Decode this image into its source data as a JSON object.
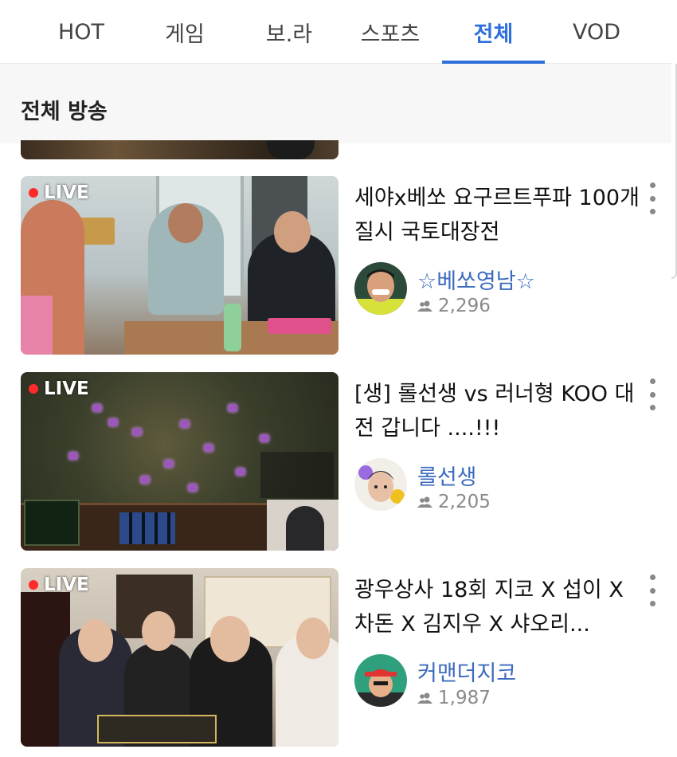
{
  "tabs": [
    {
      "label": "HOT",
      "active": false
    },
    {
      "label": "게임",
      "active": false
    },
    {
      "label": "보.라",
      "active": false
    },
    {
      "label": "스포츠",
      "active": false
    },
    {
      "label": "전체",
      "active": true
    },
    {
      "label": "VOD",
      "active": false
    }
  ],
  "colors": {
    "accent": "#2f6fdb",
    "channel": "#3d6bbf",
    "live_dot": "#ff2a2a"
  },
  "section": {
    "title": "전체 방송"
  },
  "streams": [
    {
      "live_label": "LIVE",
      "title": "세야x베쏘 요구르트푸파 100개 질시 국토대장전",
      "channel": "☆베쏘영남☆",
      "viewers": "2,296"
    },
    {
      "live_label": "LIVE",
      "title": "[생] 롤선생 vs 러너형 KOO 대전 갑니다 ....!!!",
      "channel": "롤선생",
      "viewers": "2,205"
    },
    {
      "live_label": "LIVE",
      "title": "광우상사 18회 지코 X 섭이 X 차돈 X 김지우 X 샤오리...",
      "channel": "커맨더지코",
      "viewers": "1,987"
    }
  ],
  "icons": {
    "viewers": "people-icon",
    "more": "more-vertical-icon"
  }
}
